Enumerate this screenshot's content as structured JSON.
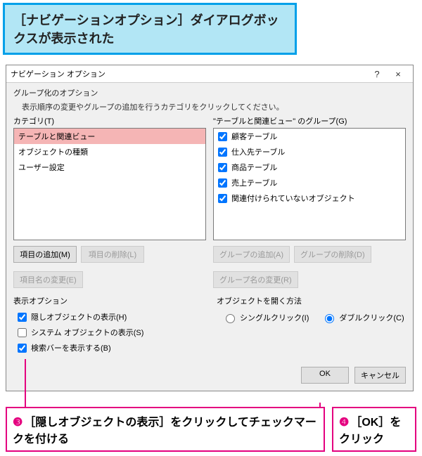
{
  "banner": "［ナビゲーションオプション］ダイアログボックスが表示された",
  "dialog": {
    "title": "ナビゲーション オプション",
    "help": "?",
    "close": "×",
    "grouping_section": "グループ化のオプション",
    "hint": "表示順序の変更やグループの追加を行うカテゴリをクリックしてください。",
    "category_label": "カテゴリ(T)",
    "groups_label": "\"テーブルと関連ビュー\" のグループ(G)",
    "categories": [
      {
        "label": "テーブルと関連ビュー",
        "selected": true
      },
      {
        "label": "オブジェクトの種類",
        "selected": false
      },
      {
        "label": "ユーザー設定",
        "selected": false
      }
    ],
    "groups": [
      {
        "label": "顧客テーブル",
        "checked": true
      },
      {
        "label": "仕入先テーブル",
        "checked": true
      },
      {
        "label": "商品テーブル",
        "checked": true
      },
      {
        "label": "売上テーブル",
        "checked": true
      },
      {
        "label": "関連付けられていないオブジェクト",
        "checked": true
      }
    ],
    "buttons_left": {
      "add_item": "項目の追加(M)",
      "del_item": "項目の削除(L)",
      "rename_item": "項目名の変更(E)"
    },
    "buttons_right": {
      "add_group": "グループの追加(A)",
      "del_group": "グループの削除(D)",
      "rename_group": "グループ名の変更(R)"
    },
    "display_section": "表示オプション",
    "display_opts": {
      "hidden": {
        "label": "隠しオブジェクトの表示(H)",
        "checked": true
      },
      "system": {
        "label": "システム オブジェクトの表示(S)",
        "checked": false
      },
      "search": {
        "label": "検索バーを表示する(B)",
        "checked": true
      }
    },
    "open_section": "オブジェクトを開く方法",
    "open_opts": {
      "single": "シングルクリック(I)",
      "double": "ダブルクリック(C)"
    },
    "footer": {
      "ok": "OK",
      "cancel": "キャンセル"
    }
  },
  "callouts": {
    "c3": {
      "num": "❸",
      "text": "［隠しオブジェクトの表示］をクリックしてチェックマークを付ける"
    },
    "c4": {
      "num": "❹",
      "text": "［OK］をクリック"
    }
  }
}
